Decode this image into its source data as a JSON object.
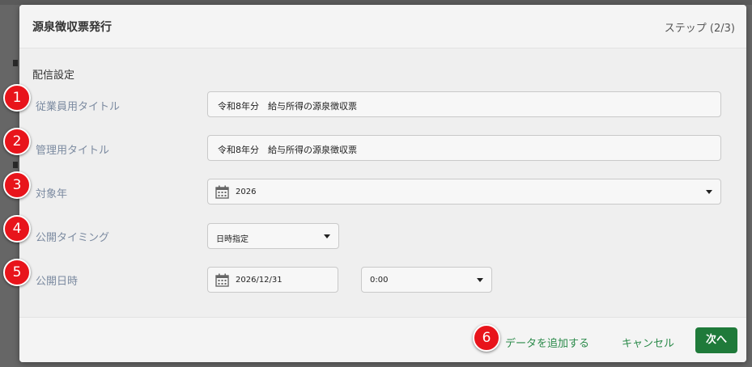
{
  "header": {
    "title": "源泉徴収票発行",
    "step": "ステップ (2/3)"
  },
  "body": {
    "section_title": "配信設定",
    "fields": [
      {
        "badge": "1",
        "label": "従業員用タイトル",
        "value": "令和8年分　給与所得の源泉徴収票"
      },
      {
        "badge": "2",
        "label": "管理用タイトル",
        "value": "令和8年分　給与所得の源泉徴収票"
      },
      {
        "badge": "3",
        "label": "対象年",
        "value": "2026"
      },
      {
        "badge": "4",
        "label": "公開タイミング",
        "value": "日時指定"
      },
      {
        "badge": "5",
        "label": "公開日時",
        "date_value": "2026/12/31",
        "time_value": "0:00"
      }
    ]
  },
  "footer": {
    "badge": "6",
    "add_data_label": "データを追加する",
    "cancel_label": "キャンセル",
    "next_label": "次へ"
  },
  "colors": {
    "badge": "#e8141b",
    "primary": "#1f7a3a",
    "link": "#2b8a4a",
    "label": "#7b8aa0"
  },
  "icons": {
    "calendar": "calendar-icon",
    "caret": "caret-down-icon"
  }
}
